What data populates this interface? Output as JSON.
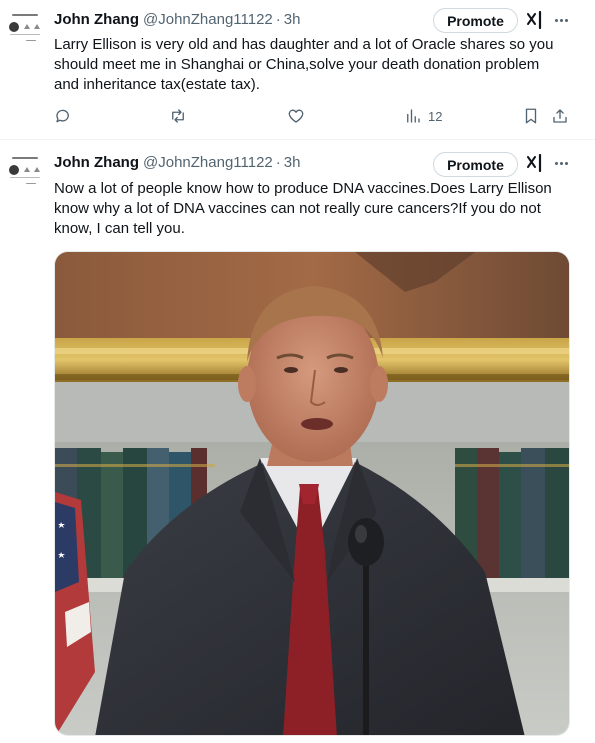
{
  "tweets": [
    {
      "name": "John Zhang",
      "handle": "@JohnZhang11122",
      "separator": "·",
      "time": "3h",
      "promote_label": "Promote",
      "text_lines": [
        "Larry Ellison is very old and has daughter and a lot of Oracle shares so you",
        "should meet me in Shanghai or China,solve your death donation problem",
        "and inheritance tax(estate tax)."
      ],
      "views": "12"
    },
    {
      "name": "John Zhang",
      "handle": "@JohnZhang11122",
      "separator": "·",
      "time": "3h",
      "promote_label": "Promote",
      "text_lines": [
        "Now a lot of people know how to produce DNA vaccines.Does Larry Ellison",
        "know why a lot of DNA vaccines can not really cure cancers?If you do not",
        "know, I can tell you."
      ]
    }
  ],
  "icons": {
    "reply": "reply-icon",
    "retweet": "retweet-icon",
    "like": "like-icon",
    "views": "views-icon",
    "bookmark": "bookmark-icon",
    "share": "share-icon",
    "grok": "grok-icon",
    "more": "more-icon"
  },
  "colors": {
    "text": "#0f1419",
    "secondary": "#536471",
    "border": "#cfd9de"
  }
}
